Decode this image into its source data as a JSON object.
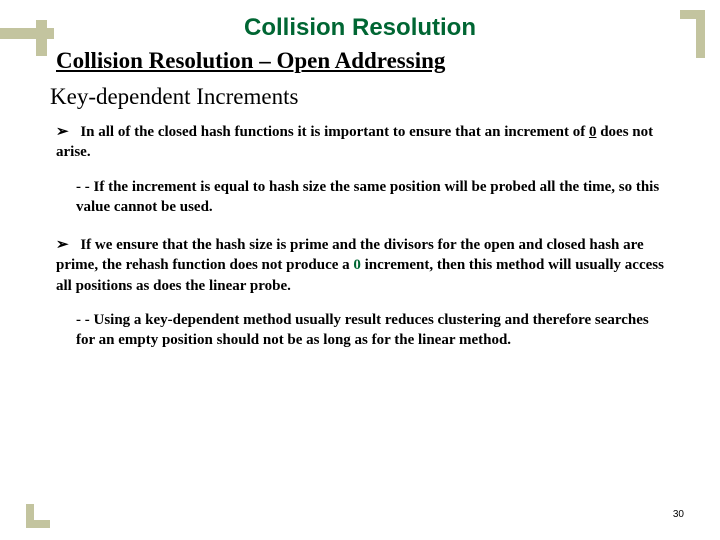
{
  "title": "Collision Resolution",
  "subtitle": "Collision Resolution – Open Addressing",
  "section": "Key-dependent Increments",
  "bullet_marker": "➢",
  "bullets": [
    {
      "pre": "In all of the closed hash functions it is important to ensure that an increment of ",
      "highlight": "0",
      "post": " does not arise."
    },
    {
      "pre": "If we ensure that the hash size is prime and the divisors for the open and closed hash are prime, the rehash function does not produce a ",
      "highlight": "0",
      "post": " increment, then this method will usually access all positions as does the linear probe."
    }
  ],
  "subitems": [
    "- - If the increment is equal to hash size the same position will be probed all the time, so this value cannot be used.",
    "- - Using a key-dependent method usually result reduces clustering and therefore searches for an empty position should not be as long as for the linear method."
  ],
  "page_number": "30"
}
